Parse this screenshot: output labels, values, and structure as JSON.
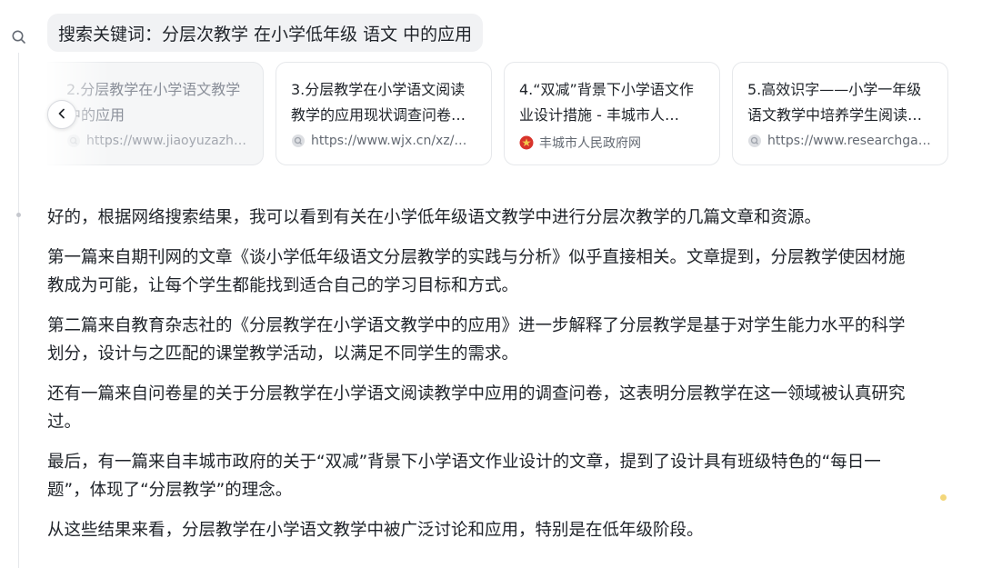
{
  "search": {
    "label": "搜索关键词：分层次教学 在小学低年级 语文 中的应用"
  },
  "cards": [
    {
      "title": "2.分层教学在小学语文教学中的应用",
      "source": "https://www.jiaoyuzazhis…",
      "icon": "globe-icon"
    },
    {
      "title": "3.分层教学在小学语文阅读教学的应用现状调查问卷…",
      "source": "https://www.wjx.cn/xz/3…",
      "icon": "globe-icon"
    },
    {
      "title": "4.“双减”背景下小学语文作业设计措施 - 丰城市人…",
      "source": "丰城市人民政府网",
      "icon": "emblem-icon"
    },
    {
      "title": "5.高效识字——小学一年级语文教学中培养学生阅读…",
      "source": "https://www.researchgat…",
      "icon": "globe-icon"
    }
  ],
  "answer": {
    "paragraphs": [
      "好的，根据网络搜索结果，我可以看到有关在小学低年级语文教学中进行分层次教学的几篇文章和资源。",
      "第一篇来自期刊网的文章《谈小学低年级语文分层教学的实践与分析》似乎直接相关。文章提到，分层教学使因材施教成为可能，让每个学生都能找到适合自己的学习目标和方式。",
      "第二篇来自教育杂志社的《分层教学在小学语文教学中的应用》进一步解释了分层教学是基于对学生能力水平的科学划分，设计与之匹配的课堂教学活动，以满足不同学生的需求。",
      "还有一篇来自问卷星的关于分层教学在小学语文阅读教学中应用的调查问卷，这表明分层教学在这一领域被认真研究过。",
      "最后，有一篇来自丰城市政府的关于“双减”背景下小学语文作业设计的文章，提到了设计具有班级特色的“每日一题”，体现了“分层教学”的理念。",
      "从这些结果来看，分层教学在小学语文教学中被广泛讨论和应用，特别是在低年级阶段。"
    ]
  },
  "colors": {
    "text": "#1f2329",
    "muted": "#646a73",
    "chip_bg": "#f1f2f4",
    "card_border": "#e6e8eb",
    "emblem_red": "#d8332b",
    "emblem_gold": "#f2c84b"
  }
}
